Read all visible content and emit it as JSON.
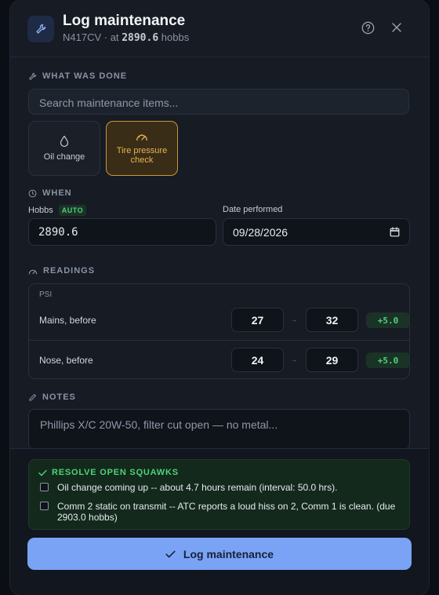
{
  "header": {
    "title": "Log maintenance",
    "tail": "N417CV",
    "at_label": "· at",
    "hobbs_value": "2890.6",
    "hobbs_unit": "hobbs"
  },
  "what": {
    "label": "WHAT WAS DONE",
    "search_placeholder": "Search maintenance items...",
    "chips": [
      {
        "label": "Oil change",
        "icon": "droplet-icon",
        "selected": false
      },
      {
        "label": "Tire pressure check",
        "icon": "gauge-icon",
        "selected": true
      }
    ]
  },
  "when": {
    "label": "WHEN",
    "hobbs_label": "Hobbs",
    "auto_badge": "AUTO",
    "hobbs_value": "2890.6",
    "date_label": "Date performed",
    "date_value": "09/28/2026"
  },
  "readings": {
    "label": "READINGS",
    "unit": "PSI",
    "rows": [
      {
        "label": "Mains, before",
        "before": "27",
        "after": "32",
        "delta": "+5.0"
      },
      {
        "label": "Nose, before",
        "before": "24",
        "after": "29",
        "delta": "+5.0"
      }
    ],
    "arrow": "→"
  },
  "notes": {
    "label": "NOTES",
    "placeholder": "Phillips X/C 20W-50, filter cut open — no metal..."
  },
  "squawks": {
    "title": "RESOLVE OPEN SQUAWKS",
    "items": [
      {
        "text": "Oil change coming up -- about 4.7 hours remain (interval: 50.0 hrs).",
        "checked": false
      },
      {
        "text": "Comm 2 static on transmit -- ATC reports a loud hiss on 2, Comm 1 is clean. (due 2903.0 hobbs)",
        "checked": false
      }
    ]
  },
  "submit": {
    "label": "Log maintenance"
  },
  "colors": {
    "accent": "#7aa3f5",
    "selected_chip": "#c89638",
    "success": "#4ed27a",
    "background": "#161b24"
  }
}
